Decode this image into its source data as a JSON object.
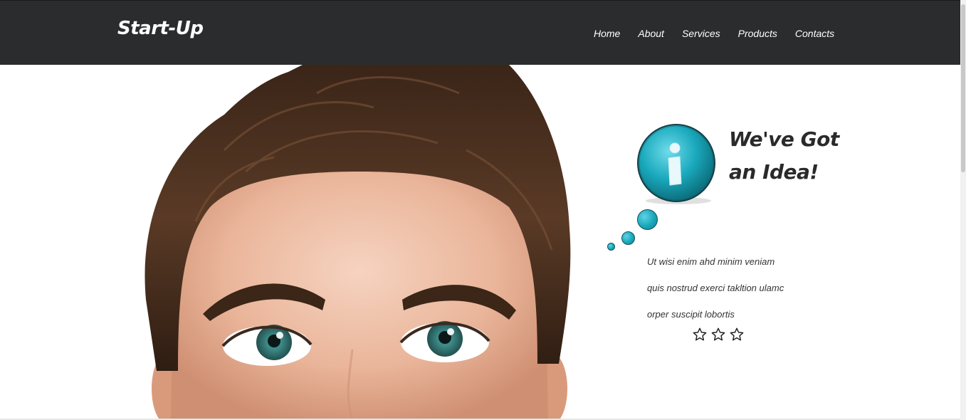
{
  "header": {
    "logo": "Start-Up",
    "nav": [
      "Home",
      "About",
      "Services",
      "Products",
      "Contacts"
    ]
  },
  "hero": {
    "image": "man-looking-up-photo",
    "info_icon": "info-bubble-icon",
    "title_line1": "We've Got",
    "title_line2": "an Idea!",
    "text_lines": [
      "Ut wisi enim ahd minim veniam",
      "quis nostrud exerci takltion ulamc",
      "orper suscipit lobortis"
    ],
    "rating": {
      "stars": 3,
      "filled": 0
    }
  },
  "colors": {
    "header_bg": "#2b2c2e",
    "accent": "#18a7ba",
    "text_dark": "#2a2a2a"
  }
}
